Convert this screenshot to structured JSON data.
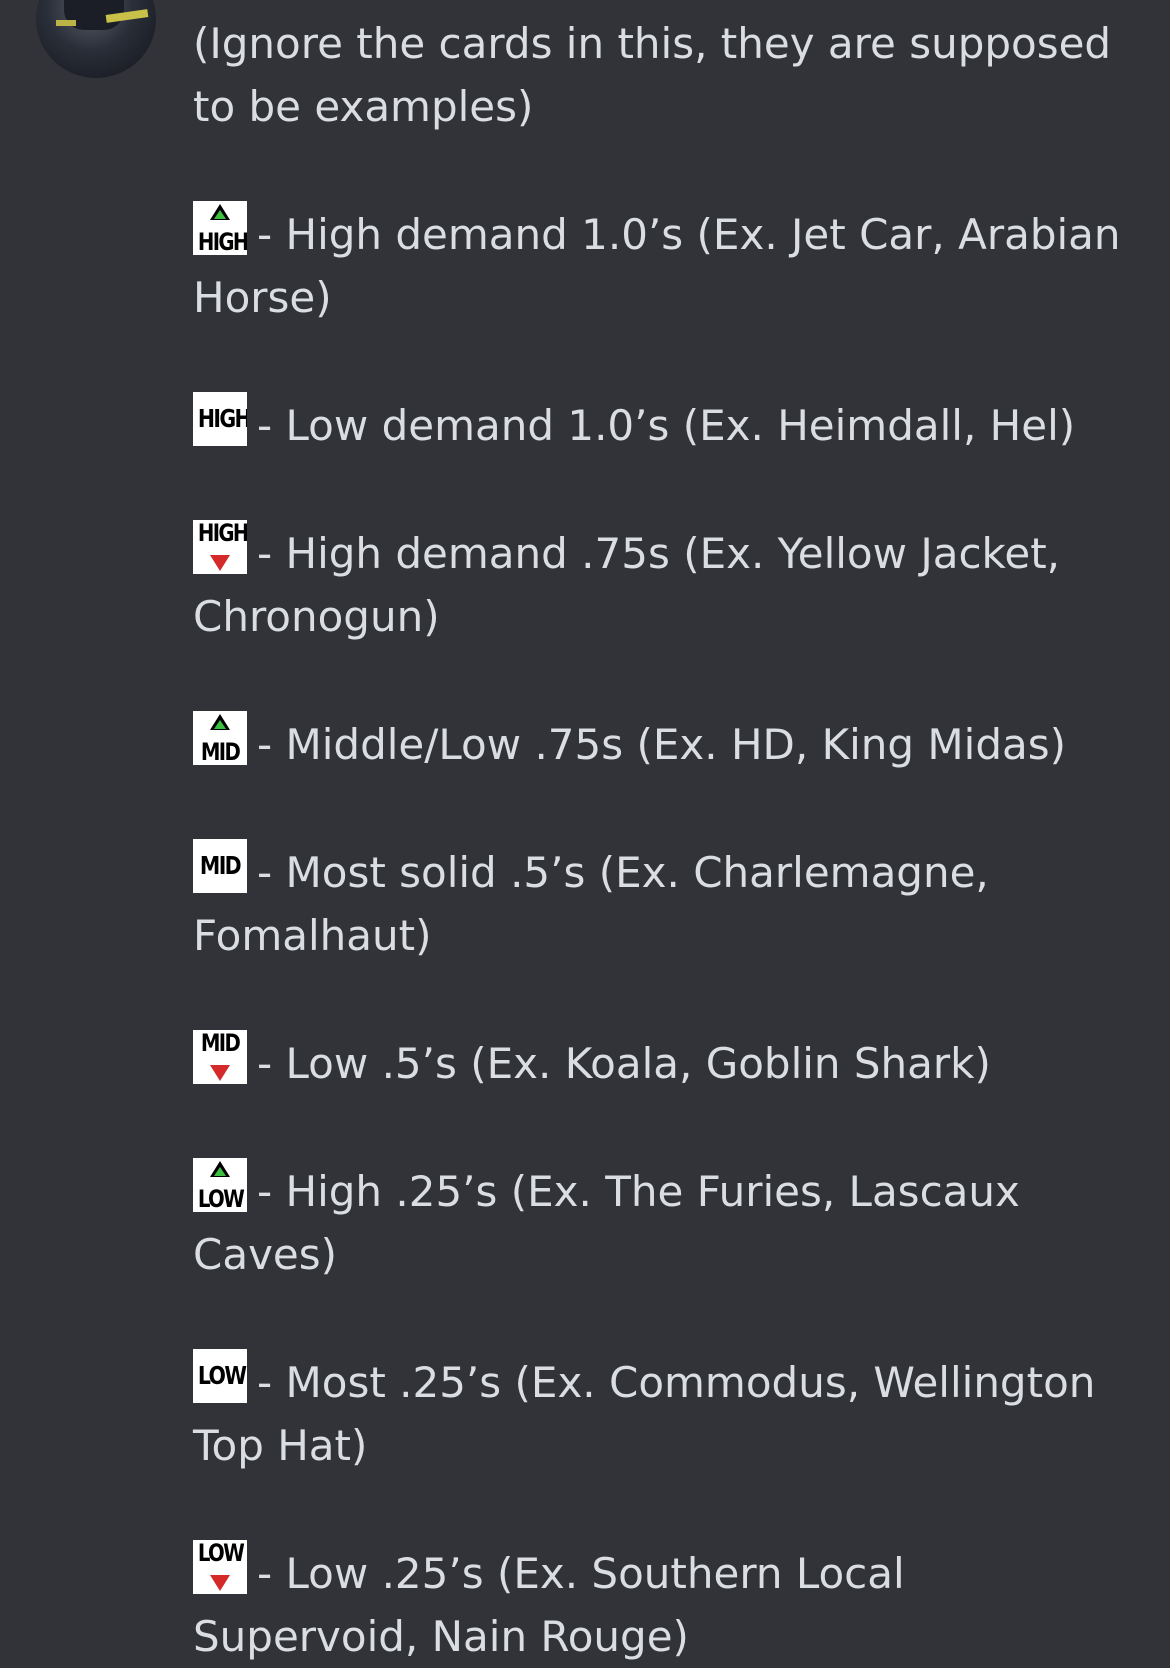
{
  "message": {
    "intro": "(Ignore the cards in this, they are supposed to be examples)",
    "tiers": [
      {
        "badge": "HIGH",
        "modifier": "up",
        "text": "- High demand 1.0’s (Ex. Jet Car, Arabian Horse)"
      },
      {
        "badge": "HIGH",
        "modifier": "none",
        "text": "- Low demand 1.0’s (Ex. Heimdall, Hel)"
      },
      {
        "badge": "HIGH",
        "modifier": "down",
        "text": "- High demand .75s (Ex. Yellow Jacket, Chronogun)"
      },
      {
        "badge": "MID",
        "modifier": "up",
        "text": "- Middle/Low .75s (Ex. HD, King Midas)"
      },
      {
        "badge": "MID",
        "modifier": "none",
        "text": "- Most solid .5’s (Ex. Charlemagne, Fomalhaut)"
      },
      {
        "badge": "MID",
        "modifier": "down",
        "text": "- Low .5’s (Ex. Koala, Goblin Shark)"
      },
      {
        "badge": "LOW",
        "modifier": "up",
        "text": "- High .25’s (Ex. The Furies, Lascaux Caves)"
      },
      {
        "badge": "LOW",
        "modifier": "none",
        "text": "- Most .25’s (Ex. Commodus, Wellington Top Hat)"
      },
      {
        "badge": "LOW",
        "modifier": "down",
        "text": "- Low .25’s (Ex. Southern Local Supervoid, Nain Rouge)"
      }
    ]
  },
  "colors": {
    "background": "#313338",
    "text": "#dbdee1",
    "arrow_up": "#3fbf3f",
    "arrow_down": "#d42a2a"
  }
}
